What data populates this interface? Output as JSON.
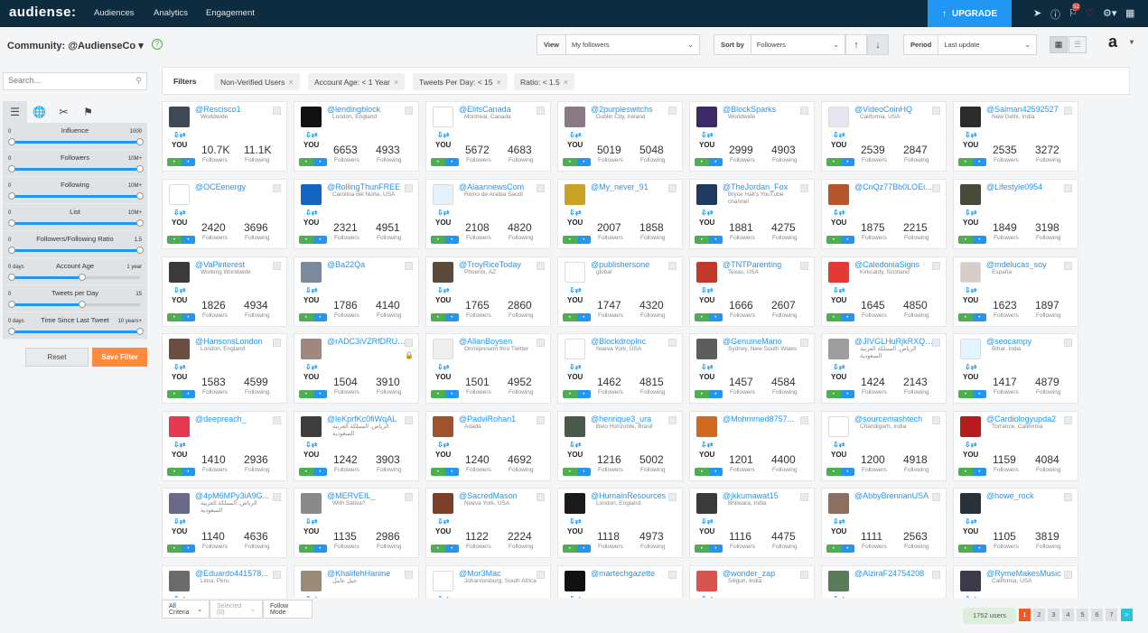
{
  "topbar": {
    "logo": "audiense:",
    "nav": [
      "Audiences",
      "Analytics",
      "Engagement"
    ],
    "upgrade_label": "UPGRADE",
    "notification_count": "52"
  },
  "header": {
    "community_label": "Community: @AudienseCo",
    "view_label": "View",
    "view_value": "My followers",
    "sort_label": "Sort by",
    "sort_value": "Followers",
    "period_label": "Period",
    "period_value": "Last update",
    "avatar_letter": "a"
  },
  "sidebar": {
    "search_placeholder": "Search...",
    "sliders": [
      {
        "title": "Influence",
        "min": "0",
        "max": "1000",
        "level_low": 0,
        "level_high": 1
      },
      {
        "title": "Followers",
        "min": "0",
        "max": "10M+",
        "level_low": 0,
        "level_high": 1
      },
      {
        "title": "Following",
        "min": "0",
        "max": "10M+",
        "level_low": 0,
        "level_high": 1
      },
      {
        "title": "List",
        "min": "0",
        "max": "10M+",
        "level_low": 0,
        "level_high": 1
      },
      {
        "title": "Followers/Following Ratio",
        "min": "0",
        "max": "1.5",
        "level_low": 0,
        "level_high": 1
      },
      {
        "title": "Account Age",
        "min": "0 days",
        "max": "1 year",
        "level_low": 0,
        "level_high": 0.55
      },
      {
        "title": "Tweets per Day",
        "min": "0",
        "max": "15",
        "level_low": 0,
        "level_high": 0.55
      },
      {
        "title": "Time Since Last Tweet",
        "min": "0 days",
        "max": "10 years+",
        "level_low": 0,
        "level_high": 1
      }
    ],
    "reset_label": "Reset",
    "save_label": "Save Filter"
  },
  "filters": {
    "label": "Filters",
    "chips": [
      "Non-Verified Users",
      "Account Age: < 1 Year",
      "Tweets Per Day: < 15",
      "Ratio: < 1.5"
    ]
  },
  "cards": [
    {
      "handle": "@Rescisco1",
      "loc": "Worldwide",
      "followers": "10.7K",
      "following": "11.1K",
      "color": "#3d4a56"
    },
    {
      "handle": "@lendingblock",
      "loc": "London, England",
      "followers": "6653",
      "following": "4933",
      "color": "#111111"
    },
    {
      "handle": "@ElitsCanada",
      "loc": "Montreal, Canada",
      "followers": "5672",
      "following": "4683",
      "color": "#ffffff"
    },
    {
      "handle": "@2purpleswitchs",
      "loc": "Dublin City, Ireland",
      "followers": "5019",
      "following": "5048",
      "color": "#8a7a86"
    },
    {
      "handle": "@BlockSparks",
      "loc": "Worldwide",
      "followers": "2999",
      "following": "4903",
      "color": "#3b2a66"
    },
    {
      "handle": "@VideoCoinHQ",
      "loc": "California, USA",
      "followers": "2539",
      "following": "2847",
      "color": "#e9e4f2"
    },
    {
      "handle": "@Salman42592527",
      "loc": "New Delhi, India",
      "followers": "2535",
      "following": "3272",
      "color": "#2b2b2b"
    },
    {
      "handle": "@OCEenergy",
      "loc": "",
      "followers": "2420",
      "following": "3696",
      "color": "#ffffff"
    },
    {
      "handle": "@RollingThunFREE",
      "loc": "Carolina del Norte, USA",
      "followers": "2321",
      "following": "4951",
      "color": "#1565c0"
    },
    {
      "handle": "@AlaannewsCom",
      "loc": "Reino de Arabia Saudí",
      "followers": "2108",
      "following": "4820",
      "color": "#e3f2fd"
    },
    {
      "handle": "@My_never_91",
      "loc": "",
      "followers": "2007",
      "following": "1858",
      "color": "#c9a227"
    },
    {
      "handle": "@TheJordan_Fox",
      "loc": "Bryce Hall's YouTube channel",
      "followers": "1881",
      "following": "4275",
      "color": "#1e3a5f"
    },
    {
      "handle": "@CnQz77Bb0LOEi...",
      "loc": "",
      "followers": "1875",
      "following": "2215",
      "color": "#b5552c"
    },
    {
      "handle": "@Lifestyle0954",
      "loc": "",
      "followers": "1849",
      "following": "3198",
      "color": "#4a4a3a"
    },
    {
      "handle": "@VaPinterest",
      "loc": "Working Worldwide",
      "followers": "1826",
      "following": "4934",
      "color": "#3a3a3a"
    },
    {
      "handle": "@Ba22Qa",
      "loc": "",
      "followers": "1786",
      "following": "4140",
      "color": "#7a8a9a"
    },
    {
      "handle": "@TroyRiceToday",
      "loc": "Phoenix, AZ",
      "followers": "1765",
      "following": "2860",
      "color": "#5a4a3a"
    },
    {
      "handle": "@publishersone",
      "loc": "global",
      "followers": "1747",
      "following": "4320",
      "color": "#ffffff"
    },
    {
      "handle": "@TNTParenting",
      "loc": "Texas, USA",
      "followers": "1666",
      "following": "2607",
      "color": "#c0392b"
    },
    {
      "handle": "@CaledoniaSigns",
      "loc": "Kirkcaldy, Scotland",
      "followers": "1645",
      "following": "4850",
      "color": "#e53935"
    },
    {
      "handle": "@mdelucas_soy",
      "loc": "España",
      "followers": "1623",
      "following": "1897",
      "color": "#d7ccc8"
    },
    {
      "handle": "@HansonsLondon",
      "loc": "London, England",
      "followers": "1583",
      "following": "4599",
      "color": "#6d4c41"
    },
    {
      "handle": "@rADC3iVZRfDRUBk",
      "loc": "",
      "followers": "1504",
      "following": "3910",
      "color": "#a1887f"
    },
    {
      "handle": "@AllanBoysen",
      "loc": "Omnipresent thru Twitter",
      "followers": "1501",
      "following": "4952",
      "color": "#eeeeee"
    },
    {
      "handle": "@BlockdropInc",
      "loc": "Nueva York, USA",
      "followers": "1462",
      "following": "4815",
      "color": "#ffffff"
    },
    {
      "handle": "@GenuineMario",
      "loc": "Sydney, New South Wales",
      "followers": "1457",
      "following": "4584",
      "color": "#5d5d5d"
    },
    {
      "handle": "@JIVGLHuRjkRXQL6",
      "loc": "الرياض, المملكة العربية السعودية",
      "followers": "1424",
      "following": "2143",
      "color": "#9e9e9e"
    },
    {
      "handle": "@seocampy",
      "loc": "Bihar, India",
      "followers": "1417",
      "following": "4879",
      "color": "#e1f5fe"
    },
    {
      "handle": "@deepreach_",
      "loc": "",
      "followers": "1410",
      "following": "2936",
      "color": "#e53950"
    },
    {
      "handle": "@leKprfKc0fiWqAL",
      "loc": "الرياض, المملكة العربية السعودية",
      "followers": "1242",
      "following": "3903",
      "color": "#3e3e3e"
    },
    {
      "handle": "@PadviRohan1",
      "loc": "Adada",
      "followers": "1240",
      "following": "4692",
      "color": "#a0522d"
    },
    {
      "handle": "@henrique3_ura",
      "loc": "Belo Horizonte, Brasil",
      "followers": "1216",
      "following": "5002",
      "color": "#4a5a4a"
    },
    {
      "handle": "@Mohmmed8757...",
      "loc": "",
      "followers": "1201",
      "following": "4400",
      "color": "#d2691e"
    },
    {
      "handle": "@sourcemashtech",
      "loc": "Chandigarh, India",
      "followers": "1200",
      "following": "4918",
      "color": "#ffffff"
    },
    {
      "handle": "@Cardiologyupda2",
      "loc": "Torrance, California",
      "followers": "1159",
      "following": "4084",
      "color": "#b71c1c"
    },
    {
      "handle": "@4pM6MPy3iA9G...",
      "loc": "الرياض, المملكة العربية السعودية",
      "followers": "1140",
      "following": "4636",
      "color": "#6a6a8a"
    },
    {
      "handle": "@MERVEIL_",
      "loc": "With Sativa?",
      "followers": "1135",
      "following": "2986",
      "color": "#8a8a8a"
    },
    {
      "handle": "@SacredMason",
      "loc": "Nueva York, USA",
      "followers": "1122",
      "following": "2224",
      "color": "#7b3f2a"
    },
    {
      "handle": "@HumainResources",
      "loc": "London, England",
      "followers": "1118",
      "following": "4973",
      "color": "#1a1a1a"
    },
    {
      "handle": "@jkkumawat15",
      "loc": "Bhilwara, India",
      "followers": "1116",
      "following": "4475",
      "color": "#3a3a3a"
    },
    {
      "handle": "@AbbyBrennanUSA",
      "loc": "",
      "followers": "1111",
      "following": "2563",
      "color": "#8d6e63"
    },
    {
      "handle": "@howe_rock",
      "loc": "",
      "followers": "1105",
      "following": "3819",
      "color": "#263238"
    },
    {
      "handle": "@Eduardo441578...",
      "loc": "Lima, Peru",
      "followers": "",
      "following": "",
      "color": "#6b6b6b"
    },
    {
      "handle": "@KhalifehHanine",
      "loc": "جيل عامل",
      "followers": "",
      "following": "",
      "color": "#9a8a7a"
    },
    {
      "handle": "@Mor3Mac",
      "loc": "Johannesburg, South Africa",
      "followers": "",
      "following": "",
      "color": "#ffffff"
    },
    {
      "handle": "@martechgazette",
      "loc": "",
      "followers": "",
      "following": "",
      "color": "#111111"
    },
    {
      "handle": "@wonder_zap",
      "loc": "Siliguri, India",
      "followers": "",
      "following": "",
      "color": "#d9534f"
    },
    {
      "handle": "@AlziraF24754208",
      "loc": "",
      "followers": "",
      "following": "",
      "color": "#5a7a5a"
    },
    {
      "handle": "@RymeMakesMusic",
      "loc": "California, USA",
      "followers": "",
      "following": "",
      "color": "#3a3a4a"
    }
  ],
  "card_labels": {
    "you": "YOU",
    "followers": "Followers",
    "following": "Following"
  },
  "bottom": {
    "all_criteria": "All Criteria",
    "selected": "Selected (0)",
    "follow_mode": "Follow Mode",
    "user_count": "1752 users",
    "pages": [
      "1",
      "2",
      "3",
      "4",
      "5",
      "6",
      "7"
    ],
    "next": ">"
  }
}
